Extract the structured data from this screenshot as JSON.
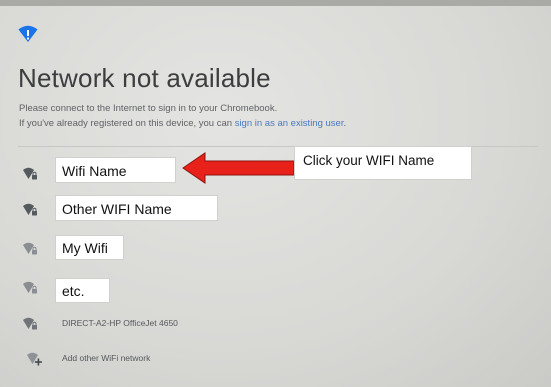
{
  "screen": {
    "title": "Network not available",
    "subtitle_line1": "Please connect to the Internet to sign in to your Chromebook.",
    "subtitle_line2_prefix": "If you've already registered on this device, you can ",
    "subtitle_link": "sign in as an existing user",
    "subtitle_line2_suffix": "."
  },
  "networks": [
    {
      "label": "Wifi Name",
      "icon": "wifi-lock-icon"
    },
    {
      "label": "Other WIFI Name",
      "icon": "wifi-lock-icon"
    },
    {
      "label": "My Wifi",
      "icon": "wifi-lock-icon"
    },
    {
      "label": "etc.",
      "icon": "wifi-lock-icon"
    },
    {
      "label": "DIRECT-A2-HP OfficeJet 4650",
      "icon": "wifi-lock-icon"
    },
    {
      "label": "Add other WiFi network",
      "icon": "wifi-add-icon"
    }
  ],
  "annotation": {
    "callout": "Click your WIFI Name",
    "arrow_color": "#e8211b"
  },
  "colors": {
    "accent": "#1a73e8",
    "link": "#4a78c0",
    "title": "#3b3d3f"
  }
}
